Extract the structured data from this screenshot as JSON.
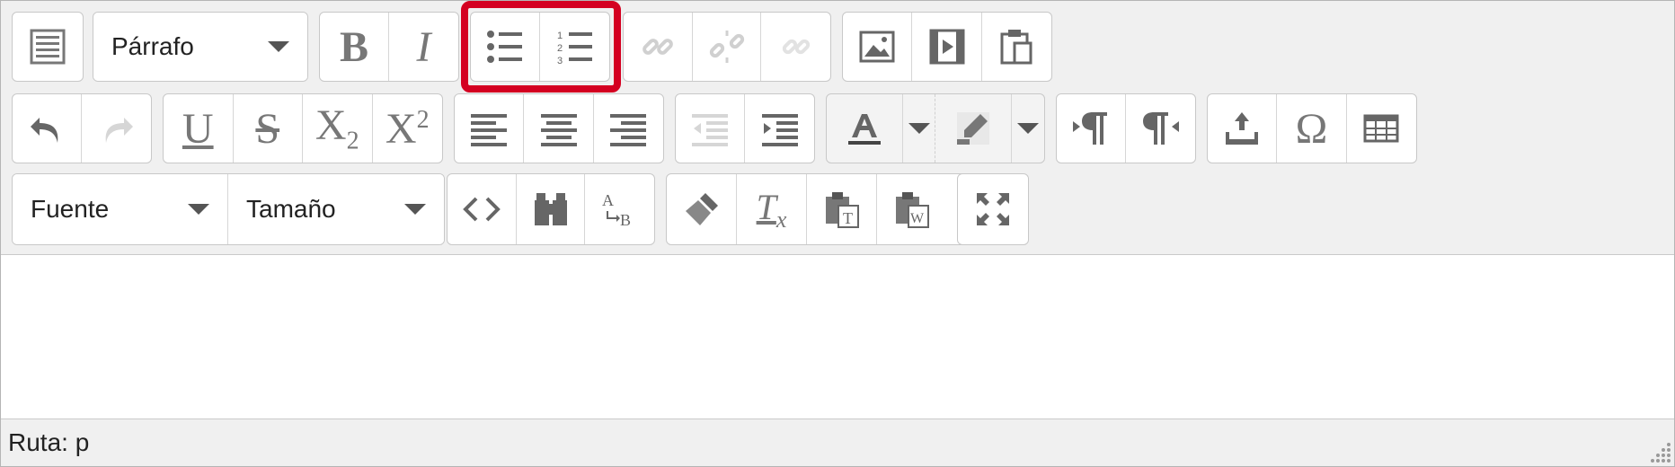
{
  "toolbar": {
    "paragraph_select": "Párrafo",
    "font_select": "Fuente",
    "size_select": "Tamaño"
  },
  "statusbar": {
    "path_label": "Ruta: p"
  },
  "colors": {
    "highlight": "#d40021",
    "icon": "#666666",
    "disabled_icon": "#cfcfcf",
    "toolbar_bg": "#f0f0f0"
  },
  "icons": [
    "toolbar-toggle-icon",
    "bold-icon",
    "italic-icon",
    "bullet-list-icon",
    "numbered-list-icon",
    "link-icon",
    "unlink-icon",
    "anchor-icon",
    "image-icon",
    "media-icon",
    "paste-icon",
    "undo-icon",
    "redo-icon",
    "underline-icon",
    "strikethrough-icon",
    "subscript-icon",
    "superscript-icon",
    "align-left-icon",
    "align-center-icon",
    "align-right-icon",
    "outdent-icon",
    "indent-icon",
    "text-color-icon",
    "background-color-icon",
    "ltr-icon",
    "rtl-icon",
    "upload-icon",
    "omega-icon",
    "table-icon",
    "code-icon",
    "find-icon",
    "spellcheck-icon",
    "clear-format-icon",
    "remove-format-icon",
    "paste-text-icon",
    "paste-word-icon",
    "fullscreen-icon"
  ]
}
